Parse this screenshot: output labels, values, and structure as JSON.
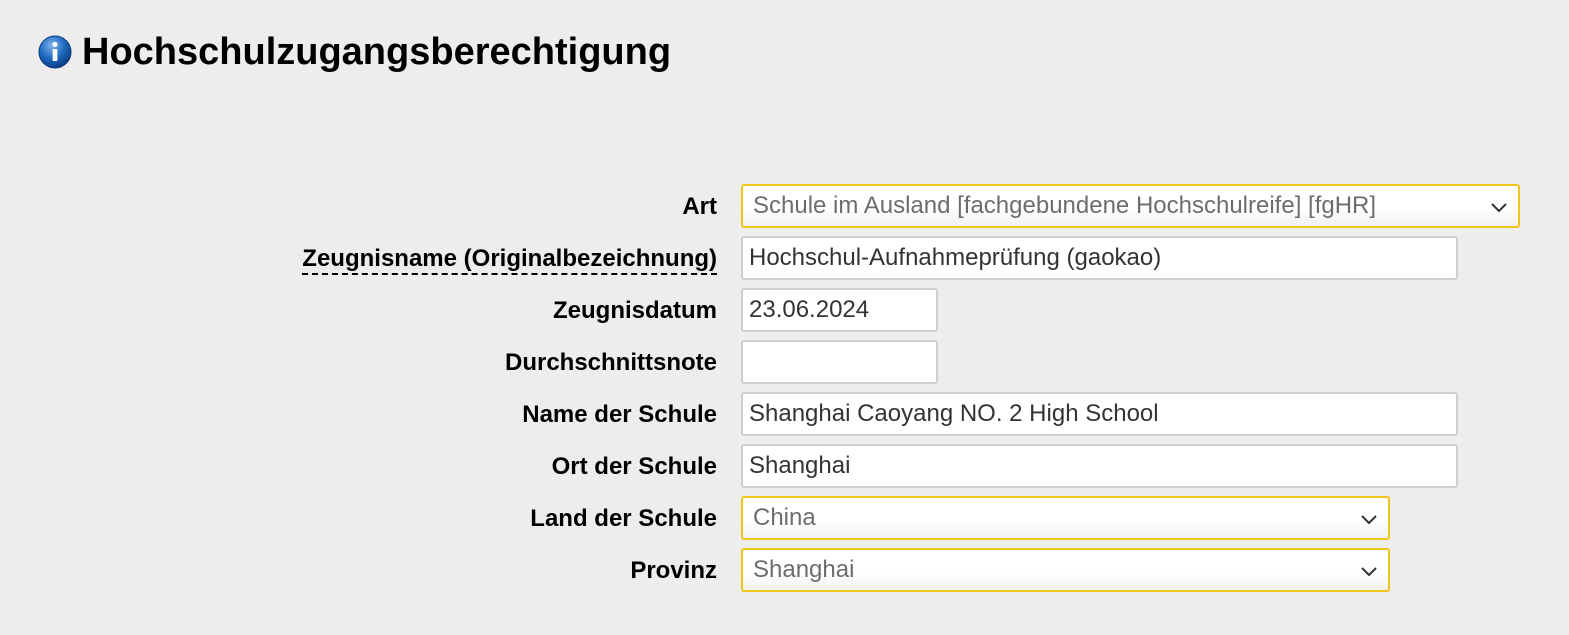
{
  "heading": {
    "title": "Hochschulzugangsberechtigung",
    "icon": "info-icon"
  },
  "form": {
    "art": {
      "label": "Art",
      "value": "Schule im Ausland [fachgebundene Hochschulreife] [fgHR]"
    },
    "zeugnisname": {
      "label": "Zeugnisname (Originalbezeichnung)",
      "value": "Hochschul-Aufnahmeprüfung (gaokao)"
    },
    "zeugnisdatum": {
      "label": "Zeugnisdatum",
      "value": "23.06.2024"
    },
    "durchschnittsnote": {
      "label": "Durchschnittsnote",
      "value": ""
    },
    "name_schule": {
      "label": "Name der Schule",
      "value": "Shanghai Caoyang NO. 2 High School"
    },
    "ort_schule": {
      "label": "Ort der Schule",
      "value": "Shanghai"
    },
    "land_schule": {
      "label": "Land der Schule",
      "value": "China"
    },
    "provinz": {
      "label": "Provinz",
      "value": "Shanghai"
    }
  },
  "colors": {
    "background": "#ededed",
    "select_border": "#f0c419",
    "input_border": "#cfcfcf",
    "icon_blue": "#1a63b8"
  }
}
